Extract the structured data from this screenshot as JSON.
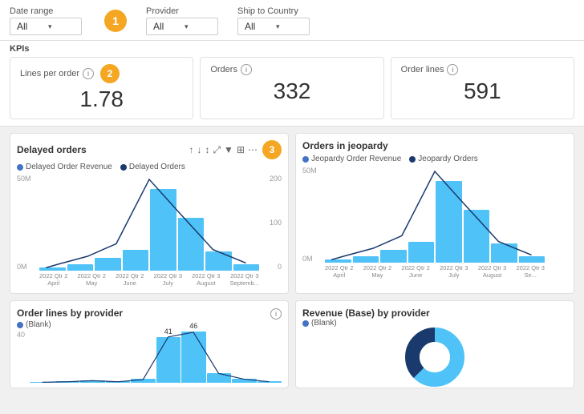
{
  "filters": {
    "dateRange": {
      "label": "Date range",
      "value": "All"
    },
    "provider": {
      "label": "Provider",
      "value": "All"
    },
    "shipToCountry": {
      "label": "Ship to Country",
      "value": "All"
    }
  },
  "badges": [
    "1",
    "2",
    "3"
  ],
  "kpi": {
    "sectionLabel": "KPIs",
    "cards": [
      {
        "title": "Lines per order",
        "value": "1.78"
      },
      {
        "title": "Orders",
        "value": "332"
      },
      {
        "title": "Order lines",
        "value": "591"
      }
    ]
  },
  "delayedOrders": {
    "title": "Delayed orders",
    "legend": [
      {
        "label": "Delayed Order Revenue",
        "color": "#4fc3f7"
      },
      {
        "label": "Delayed Orders",
        "color": "#1a3a6e"
      }
    ],
    "yLeft": [
      "50M",
      "",
      "0M"
    ],
    "yRight": [
      "200",
      "100",
      "0"
    ],
    "bars": [
      2,
      4,
      8,
      14,
      50,
      22,
      9,
      3
    ],
    "xLabels": [
      {
        "line1": "2022 Qtr 2",
        "line2": "April"
      },
      {
        "line1": "2022 Qtr 2",
        "line2": "May"
      },
      {
        "line1": "2022 Qtr 2",
        "line2": "June"
      },
      {
        "line1": "2022 Qtr 3",
        "line2": "July"
      },
      {
        "line1": "2022 Qtr 3",
        "line2": "August"
      },
      {
        "line1": "2022 Qtr 3",
        "line2": "Septemb..."
      }
    ],
    "toolbar": [
      "↑",
      "↓",
      "↕",
      "⤢",
      "▼",
      "⊞",
      "⋯"
    ]
  },
  "jeopardyOrders": {
    "title": "Orders in jeopardy",
    "legend": [
      {
        "label": "Jeopardy Order Revenue",
        "color": "#4fc3f7"
      },
      {
        "label": "Jeopardy Orders",
        "color": "#1a3a6e"
      }
    ],
    "yLeft": [
      "50M",
      "",
      "0M"
    ],
    "bars": [
      2,
      4,
      8,
      14,
      50,
      22,
      9,
      3
    ],
    "xLabels": [
      {
        "line1": "2022 Qtr 2",
        "line2": "April"
      },
      {
        "line1": "2022 Qtr 2",
        "line2": "May"
      },
      {
        "line1": "2022 Qtr 2",
        "line2": "June"
      },
      {
        "line1": "2022 Qtr 3",
        "line2": "July"
      },
      {
        "line1": "2022 Qtr 3",
        "line2": "August"
      },
      {
        "line1": "2022 Qtr 3",
        "line2": "Se..."
      }
    ]
  },
  "orderLinesByProvider": {
    "title": "Order lines by provider",
    "legend": [
      {
        "label": "(Blank)",
        "color": "#4fc3f7"
      }
    ],
    "yLabel": "40",
    "bars": [
      1,
      2,
      3,
      2,
      4,
      41,
      46,
      10,
      5,
      2
    ],
    "barLabels": [
      "41",
      "46"
    ]
  },
  "revenueByProvider": {
    "title": "Revenue (Base) by provider",
    "legend": [
      {
        "label": "(Blank)",
        "color": "#4fc3f7"
      }
    ]
  }
}
